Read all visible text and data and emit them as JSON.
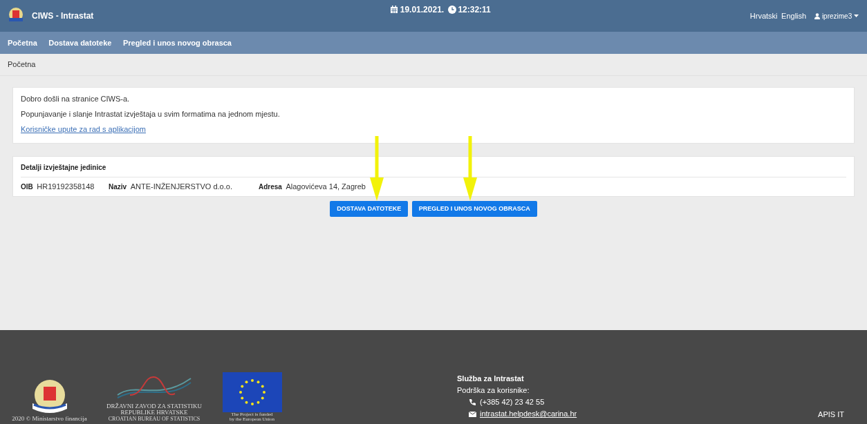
{
  "header": {
    "title": "CIWS - Intrastat",
    "date": "19.01.2021.",
    "time": "12:32:11",
    "languages": [
      {
        "label": "Hrvatski"
      },
      {
        "label": "English"
      }
    ],
    "user": "iprezime3"
  },
  "nav": [
    {
      "label": "Početna"
    },
    {
      "label": "Dostava datoteke"
    },
    {
      "label": "Pregled i unos novog obrasca"
    }
  ],
  "breadcrumb": "Početna",
  "welcome": {
    "lines": [
      "Dobro došli na stranice CIWS-a.",
      "Popunjavanje i slanje Intrastat izvještaja u svim formatima na jednom mjestu."
    ],
    "link": "Korisničke upute za rad s aplikacijom"
  },
  "details": {
    "title": "Detalji izvještajne jedinice",
    "fields": [
      {
        "label": "OIB",
        "value": "HR19192358148"
      },
      {
        "label": "Naziv",
        "value": "ANTE-INŽENJERSTVO d.o.o."
      },
      {
        "label": "Adresa",
        "value": "Alagovićeva 14, Zagreb"
      }
    ]
  },
  "buttons": [
    {
      "label": "DOSTAVA DATOTEKE"
    },
    {
      "label": "PREGLED I UNOS NOVOG OBRASCA"
    }
  ],
  "footer": {
    "customs_lines": [
      "2020 © Ministarstvo financija"
    ],
    "stats_lines": [
      "DRŽAVNI ZAVOD ZA STATISTIKU",
      "REPUBLIKE HRVATSKE",
      "CROATIAN BUREAU OF STATISTICS"
    ],
    "eu_lines": [
      "The Project is funded",
      "by the European Union"
    ],
    "service_title": "Služba za Intrastat",
    "support_label": "Podrška za korisnike:",
    "phone": "(+385 42) 23 42 55",
    "email": "intrastat.helpdesk@carina.hr",
    "vendor": "APIS IT"
  }
}
